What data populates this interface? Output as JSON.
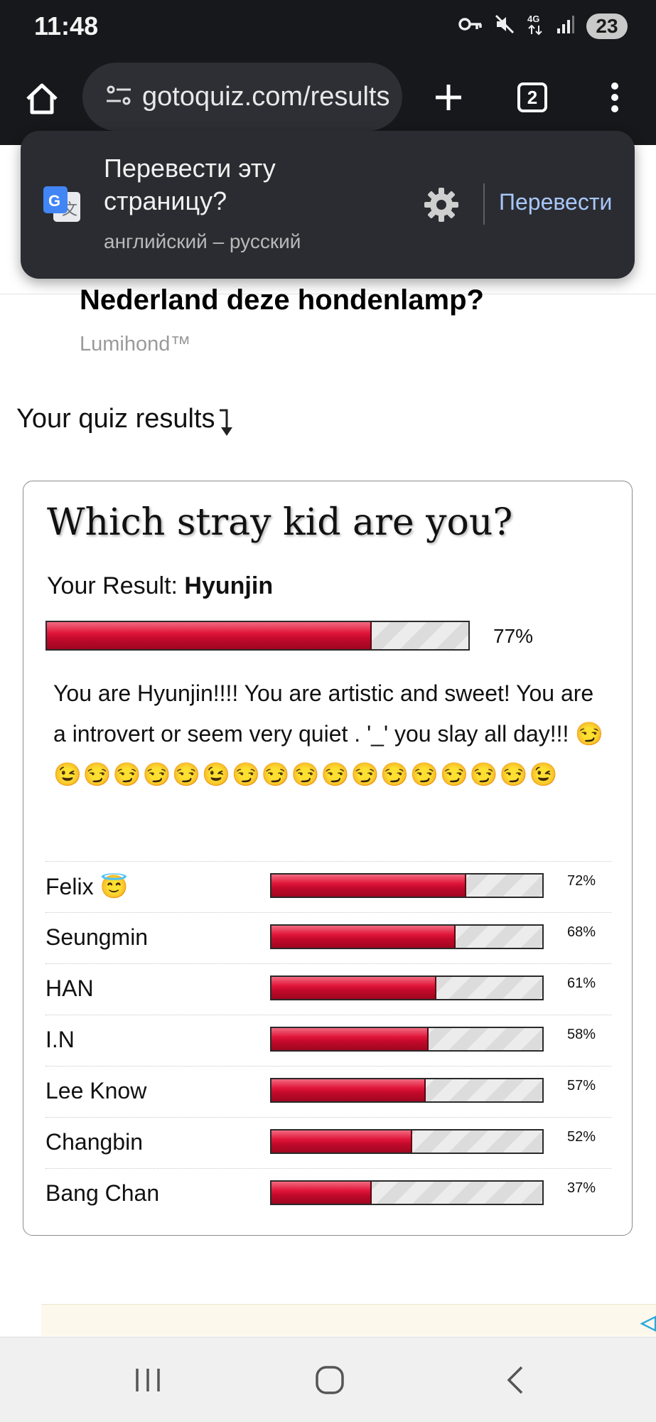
{
  "status_bar": {
    "time": "11:48",
    "battery": "23",
    "icons": [
      "key-icon",
      "mute-icon",
      "4g-icon",
      "signal-icon"
    ]
  },
  "browser": {
    "url": "gotoquiz.com/results",
    "tab_count": "2"
  },
  "translate_popup": {
    "title": "Перевести эту страницу?",
    "languages": "английский – русский",
    "translate_button": "Перевести",
    "accent_color": "#a8c7fa"
  },
  "ad": {
    "headline": "Nederland deze hondenlamp?",
    "source": "Lumihond™"
  },
  "quiz_results_label": "Your quiz results",
  "quiz": {
    "title": "Which stray kid are you?",
    "result_prefix": "Your Result:",
    "result_name": "Hyunjin",
    "result_percent": 77,
    "result_percent_label": "77%",
    "description": "You are Hyunjin!!!! You are artistic and sweet! You are a introvert or seem very quiet . '_' you slay all day!!!",
    "description_emojis": "😏😉😏😏😏😏😉😏😏😏😏😏😏😏😏😏😏😉",
    "others": [
      {
        "name": "Felix 😇",
        "percent": 72,
        "percent_label": "72%"
      },
      {
        "name": "Seungmin",
        "percent": 68,
        "percent_label": "68%"
      },
      {
        "name": "HAN",
        "percent": 61,
        "percent_label": "61%"
      },
      {
        "name": "I.N",
        "percent": 58,
        "percent_label": "58%"
      },
      {
        "name": "Lee Know",
        "percent": 57,
        "percent_label": "57%"
      },
      {
        "name": "Changbin",
        "percent": 52,
        "percent_label": "52%"
      },
      {
        "name": "Bang Chan",
        "percent": 37,
        "percent_label": "37%"
      }
    ],
    "bar_color": "#e0163a"
  },
  "nav_bar": {
    "buttons": [
      "recent-apps-icon",
      "home-icon",
      "back-icon"
    ]
  }
}
